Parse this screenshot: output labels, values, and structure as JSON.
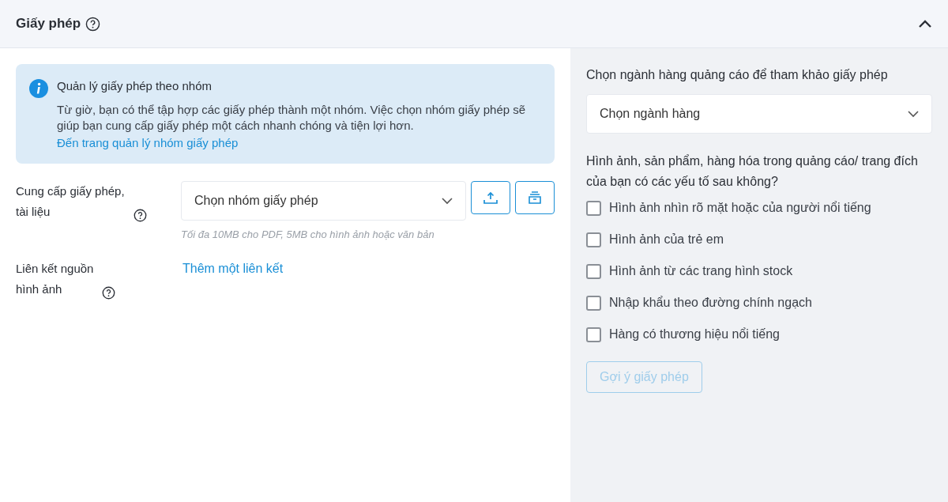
{
  "section": {
    "title": "Giấy phép",
    "expanded": true
  },
  "notice": {
    "title": "Quản lý giấy phép theo nhóm",
    "body": "Từ giờ, bạn có thể tập hợp các giấy phép thành một nhóm. Việc chọn nhóm giấy phép sẽ giúp bạn cung cấp giấy phép một cách nhanh chóng và tiện lợi hơn.",
    "link": "Đến trang quản lý nhóm giấy phép"
  },
  "license_field": {
    "label": "Cung cấp giấy phép, tài liệu",
    "select": "Chọn nhóm giấy phép",
    "hint": "Tối đa 10MB cho PDF, 5MB cho hình ảnh hoặc văn bản"
  },
  "source_link_field": {
    "label": "Liên kết nguồn hình ảnh",
    "link": "Thêm một liên kết"
  },
  "category": {
    "label": "Chọn ngành hàng quảng cáo để tham khảo giấy phép",
    "select": "Chọn ngành hàng"
  },
  "question": "Hình ảnh, sản phẩm, hàng hóa trong quảng cáo/ trang đích của bạn có các yếu tố sau không?",
  "options": [
    {
      "label": "Hình ảnh nhìn rõ mặt hoặc của người nổi tiếng",
      "checked": false
    },
    {
      "label": "Hình ảnh của trẻ em",
      "checked": false
    },
    {
      "label": "Hình ảnh từ các trang hình stock",
      "checked": false
    },
    {
      "label": "Nhập khẩu theo đường chính ngạch",
      "checked": false
    },
    {
      "label": "Hàng có thương hiệu nổi tiếng",
      "checked": false
    }
  ],
  "suggest_button": {
    "label": "Gợi ý giấy phép",
    "disabled": true
  }
}
